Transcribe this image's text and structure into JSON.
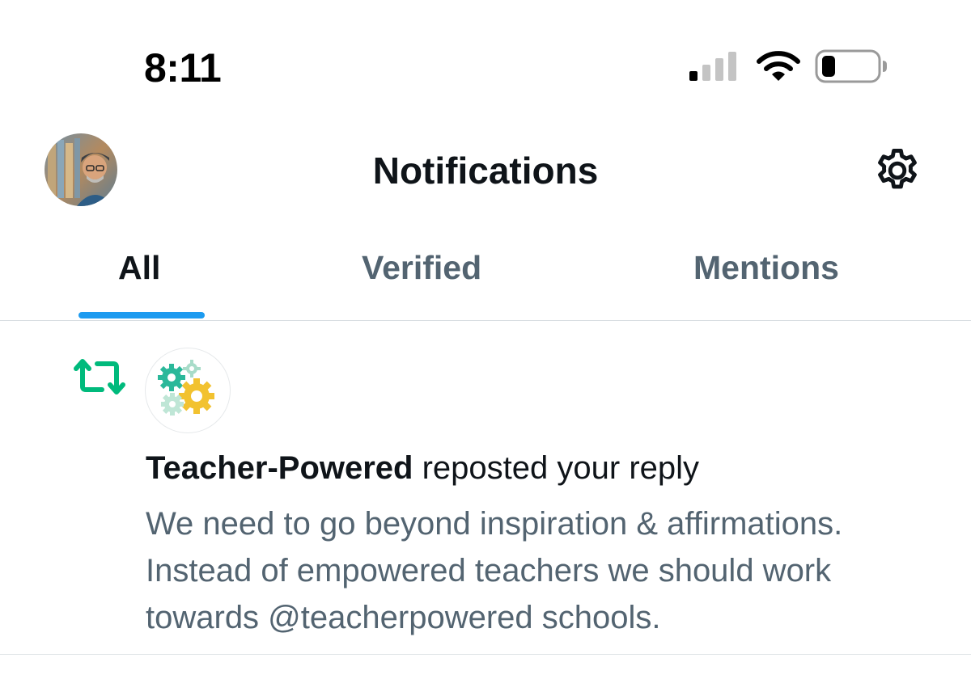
{
  "status_bar": {
    "time": "8:11",
    "icons": [
      "signal-icon",
      "wifi-icon",
      "battery-icon"
    ]
  },
  "header": {
    "title": "Notifications",
    "avatar_icon": "profile-avatar",
    "settings_icon": "gear-icon"
  },
  "tabs": [
    {
      "label": "All",
      "active": true
    },
    {
      "label": "Verified",
      "active": false
    },
    {
      "label": "Mentions",
      "active": false
    }
  ],
  "notification": {
    "type_icon": "repost-icon",
    "actor_avatar_icon": "gears-logo",
    "actor_name": "Teacher-Powered",
    "action": " reposted your reply",
    "body_lines": [
      "We need to go beyond inspiration & affirmations.",
      "Instead of empowered teachers we should work",
      "towards @teacherpowered schools."
    ]
  },
  "colors": {
    "accent": "#1d9bf0",
    "repost": "#00ba7c",
    "secondary_text": "#536471",
    "primary_text": "#0f1419"
  }
}
